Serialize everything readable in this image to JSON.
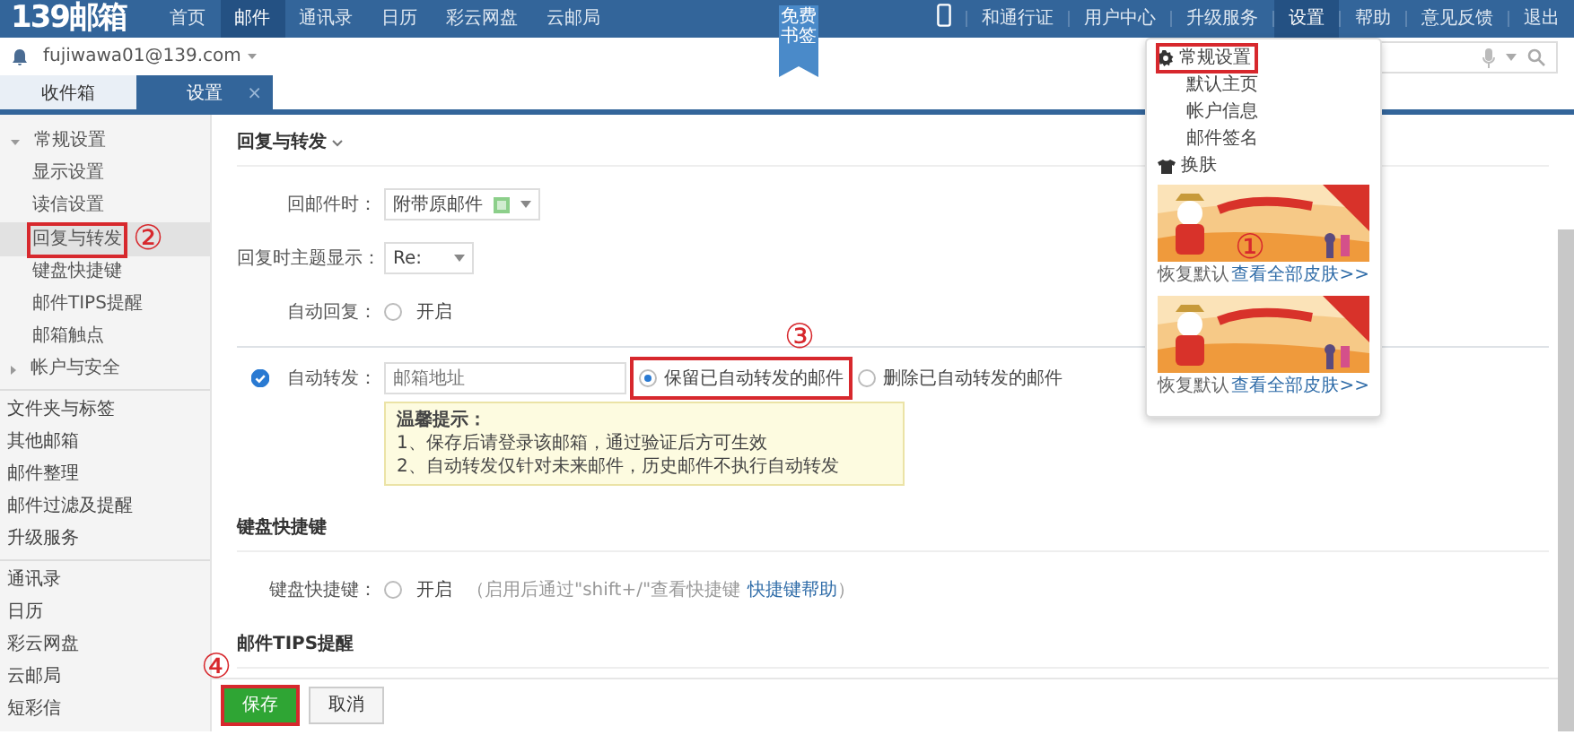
{
  "top_nav": {
    "logo": "139邮箱",
    "items": [
      {
        "label": "首页",
        "selected": false
      },
      {
        "label": "邮件",
        "selected": true
      },
      {
        "label": "通讯录",
        "selected": false
      },
      {
        "label": "日历",
        "selected": false
      },
      {
        "label": "彩云网盘",
        "selected": false
      },
      {
        "label": "云邮局",
        "selected": false
      }
    ],
    "right_items": [
      {
        "label": "和通行证",
        "selected": false
      },
      {
        "label": "用户中心",
        "selected": false
      },
      {
        "label": "升级服务",
        "selected": false
      },
      {
        "label": "设置",
        "selected": true
      },
      {
        "label": "帮助",
        "selected": false
      },
      {
        "label": "意见反馈",
        "selected": false
      },
      {
        "label": "退出",
        "selected": false
      }
    ]
  },
  "ribbon": "免费书签",
  "account": "fujiwawa01@139.com",
  "tabs": [
    {
      "label": "收件箱",
      "selected": false
    },
    {
      "label": "设置",
      "selected": true,
      "close": "×"
    }
  ],
  "sidebar": [
    {
      "items": [
        {
          "label": "常规设置",
          "expanded": true,
          "children": [
            {
              "label": "显示设置",
              "selected": false,
              "highlighted": false
            },
            {
              "label": "读信设置",
              "selected": false,
              "highlighted": false
            },
            {
              "label": "回复与转发",
              "selected": true,
              "highlighted": true,
              "marker": "②"
            },
            {
              "label": "键盘快捷键",
              "selected": false,
              "highlighted": false
            },
            {
              "label": "邮件TIPS提醒",
              "selected": false,
              "highlighted": false
            },
            {
              "label": "邮箱触点",
              "selected": false,
              "highlighted": false
            }
          ]
        },
        {
          "label": "帐户与安全",
          "expanded": false
        }
      ]
    },
    {
      "items": [
        {
          "label": "文件夹与标签"
        },
        {
          "label": "其他邮箱"
        },
        {
          "label": "邮件整理"
        },
        {
          "label": "邮件过滤及提醒"
        },
        {
          "label": "升级服务"
        }
      ]
    },
    {
      "items": [
        {
          "label": "通讯录"
        },
        {
          "label": "日历"
        },
        {
          "label": "彩云网盘"
        },
        {
          "label": "云邮局"
        },
        {
          "label": "短彩信"
        }
      ]
    }
  ],
  "section_title": "回复与转发",
  "settings": [
    {
      "kind": "select",
      "label": "回邮件时：",
      "value": "附带原邮件"
    },
    {
      "kind": "select",
      "label": "回复时主题显示：",
      "value": "Re:"
    },
    {
      "kind": "radio",
      "label": "自动回复：",
      "option": "开启",
      "checked": false
    }
  ],
  "forward": {
    "enabled": true,
    "label": "自动转发：",
    "placeholder": "邮箱地址",
    "options": [
      {
        "label": "保留已自动转发的邮件",
        "selected": true,
        "highlighted": true,
        "marker": "③"
      },
      {
        "label": "删除已自动转发的邮件",
        "selected": false,
        "highlighted": false
      }
    ],
    "tip": {
      "title": "温馨提示：",
      "lines": [
        "1、保存后请登录该邮箱，通过验证后方可生效",
        "2、自动转发仅针对未来邮件，历史邮件不执行自动转发"
      ]
    }
  },
  "shortcut": {
    "title": "键盘快捷键",
    "label": "键盘快捷键：",
    "option": "开启",
    "checked": false,
    "hint": "（启用后通过\"shift+/\"查看快捷键",
    "link": "快捷键帮助",
    "hint_end": "）"
  },
  "tips_title": "邮件TIPS提醒",
  "footer": [
    {
      "label": "保存",
      "kind": "primary",
      "highlighted": true,
      "marker": "④"
    },
    {
      "label": "取消",
      "kind": "secondary",
      "highlighted": false
    }
  ],
  "dropdown": {
    "items": [
      {
        "label": "常规设置",
        "kind": "gear",
        "highlighted": true
      },
      {
        "label": "默认主页",
        "kind": "plain",
        "highlighted": false
      },
      {
        "label": "帐户信息",
        "kind": "plain",
        "highlighted": false
      },
      {
        "label": "邮件签名",
        "kind": "plain",
        "highlighted": false
      },
      {
        "label": "换肤",
        "kind": "shirt",
        "highlighted": false
      }
    ],
    "skins": [
      {
        "kind": "picture",
        "reset": "恢复默认",
        "link": "查看全部皮肤>>",
        "marker": "①"
      },
      {
        "kind": "picture",
        "reset": "恢复默认",
        "link": "查看全部皮肤>>"
      }
    ]
  }
}
